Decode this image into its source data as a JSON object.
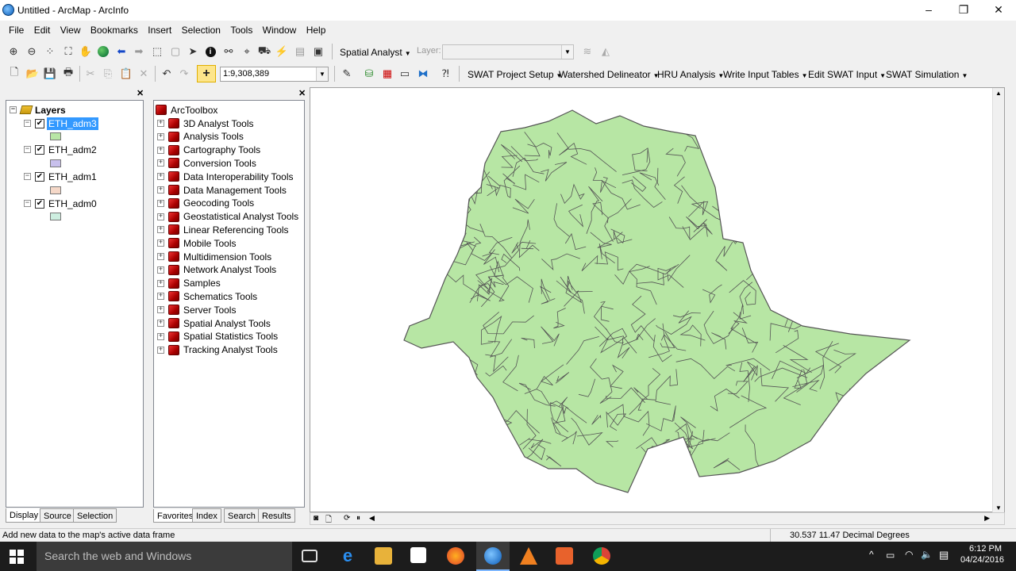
{
  "window": {
    "title": "Untitled - ArcMap - ArcInfo",
    "minimize": "–",
    "maximize": "❐",
    "close": "✕"
  },
  "menu": [
    "File",
    "Edit",
    "View",
    "Bookmarks",
    "Insert",
    "Selection",
    "Tools",
    "Window",
    "Help"
  ],
  "toolbar": {
    "spatial_analyst": "Spatial Analyst",
    "layer_label": "Layer:",
    "layer_value": "",
    "scale": "1:9,308,389",
    "swat_menus": [
      "SWAT Project Setup",
      "Watershed Delineator",
      "HRU Analysis",
      "Write Input Tables",
      "Edit SWAT Input",
      "SWAT Simulation"
    ]
  },
  "toc": {
    "root": "Layers",
    "layers": [
      {
        "name": "ETH_adm3",
        "checked": true,
        "selected": true,
        "color": "#b8e6a6"
      },
      {
        "name": "ETH_adm2",
        "checked": true,
        "selected": false,
        "color": "#c8c0ec"
      },
      {
        "name": "ETH_adm1",
        "checked": true,
        "selected": false,
        "color": "#f5d8c8"
      },
      {
        "name": "ETH_adm0",
        "checked": true,
        "selected": false,
        "color": "#cdeee0"
      }
    ],
    "tabs": [
      "Display",
      "Source",
      "Selection"
    ]
  },
  "toolbox": {
    "root": "ArcToolbox",
    "items": [
      "3D Analyst Tools",
      "Analysis Tools",
      "Cartography Tools",
      "Conversion Tools",
      "Data Interoperability Tools",
      "Data Management Tools",
      "Geocoding Tools",
      "Geostatistical Analyst Tools",
      "Linear Referencing Tools",
      "Mobile Tools",
      "Multidimension Tools",
      "Network Analyst Tools",
      "Samples",
      "Schematics Tools",
      "Server Tools",
      "Spatial Analyst Tools",
      "Spatial Statistics Tools",
      "Tracking Analyst Tools"
    ],
    "tabs": [
      "Favorites",
      "Index",
      "Search",
      "Results"
    ]
  },
  "map": {
    "fill": "#b7e6a4",
    "stroke": "#555555"
  },
  "status": {
    "message": "Add new data to the map's active data frame",
    "coords": "30.537  11.47 Decimal Degrees"
  },
  "taskbar": {
    "search_placeholder": "Search the web and Windows",
    "time": "6:12 PM",
    "date": "04/24/2016"
  }
}
